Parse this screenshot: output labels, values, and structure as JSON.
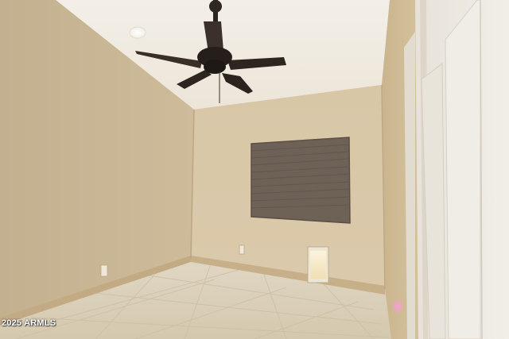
{
  "photo": {
    "watermark": "2025 ARMLS"
  },
  "colors": {
    "left_wall": "#c9b796",
    "back_wall": "#d9c8a8",
    "right_wall": "#cfbb95",
    "ceiling": "#f2ede4",
    "floor": "#dcd2bd",
    "blind": "#6e6257",
    "door": "#ede9e2",
    "fan": "#2b2420",
    "baseboard": "#c2aa84"
  }
}
